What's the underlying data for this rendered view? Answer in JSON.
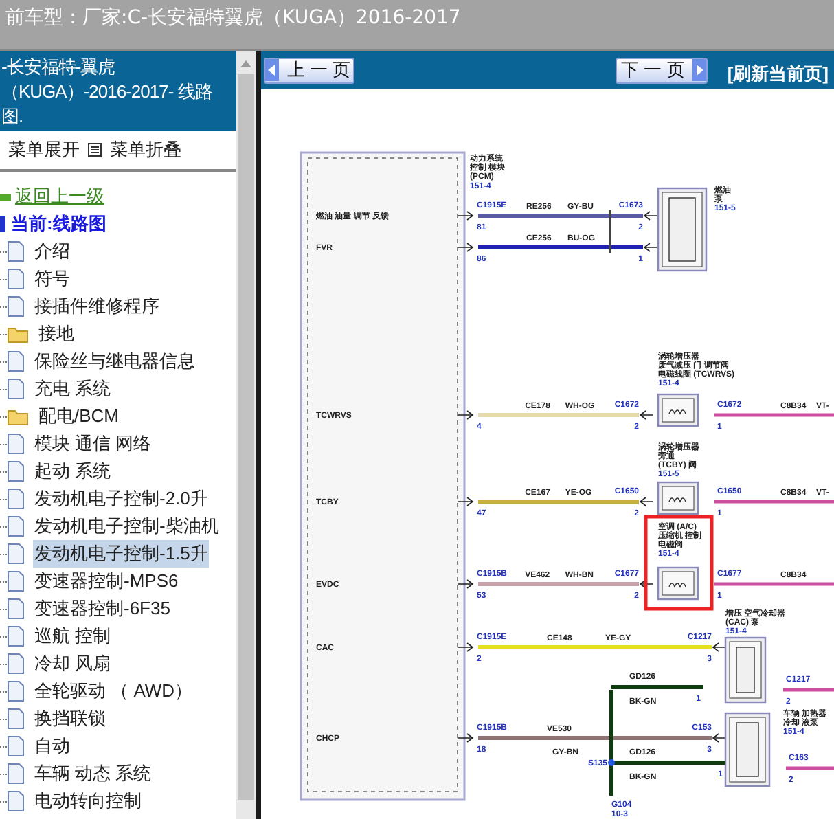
{
  "header": {
    "title": "前车型：厂家:C-长安福特翼虎（KUGA）2016-2017"
  },
  "sidebar": {
    "title_lines": [
      "-长安福特-翼虎",
      "（KUGA）-2016-2017- 线路",
      "图."
    ],
    "expand_label": "菜单展开",
    "collapse_label": "菜单折叠",
    "back_link": "返回上一级",
    "current": "当前:线路图",
    "items": [
      {
        "label": "介绍",
        "kind": "doc",
        "selected": false
      },
      {
        "label": "符号",
        "kind": "doc",
        "selected": false
      },
      {
        "label": "接插件维修程序",
        "kind": "doc",
        "selected": false
      },
      {
        "label": "接地",
        "kind": "folder",
        "selected": false
      },
      {
        "label": "保险丝与继电器信息",
        "kind": "doc",
        "selected": false
      },
      {
        "label": "充电 系统",
        "kind": "doc",
        "selected": false
      },
      {
        "label": "配电/BCM",
        "kind": "folder",
        "selected": false
      },
      {
        "label": "模块 通信 网络",
        "kind": "doc",
        "selected": false
      },
      {
        "label": "起动 系统",
        "kind": "doc",
        "selected": false
      },
      {
        "label": "发动机电子控制-2.0升",
        "kind": "doc",
        "selected": false
      },
      {
        "label": "发动机电子控制-柴油机",
        "kind": "doc",
        "selected": false
      },
      {
        "label": "发动机电子控制-1.5升",
        "kind": "doc",
        "selected": true
      },
      {
        "label": "变速器控制-MPS6",
        "kind": "doc",
        "selected": false
      },
      {
        "label": "变速器控制-6F35",
        "kind": "doc",
        "selected": false
      },
      {
        "label": "巡航 控制",
        "kind": "doc",
        "selected": false
      },
      {
        "label": "冷却 风扇",
        "kind": "doc",
        "selected": false
      },
      {
        "label": "全轮驱动 （ AWD）",
        "kind": "doc",
        "selected": false
      },
      {
        "label": "换挡联锁",
        "kind": "doc",
        "selected": false
      },
      {
        "label": "自动",
        "kind": "doc",
        "selected": false
      },
      {
        "label": "车辆 动态 系统",
        "kind": "doc",
        "selected": false
      },
      {
        "label": "电动转向控制",
        "kind": "doc",
        "selected": false
      }
    ]
  },
  "nav": {
    "prev": "上 一 页",
    "next": "下 一 页",
    "refresh": "[刷新当前页]"
  },
  "diagram": {
    "module": {
      "title_lines": [
        "动力系统",
        "控制 模块",
        "(PCM)"
      ],
      "ref": "151-4"
    },
    "wires": [
      {
        "signal": "燃油 油量 调节 反馈",
        "connector": "C1915E",
        "pin": "81",
        "circuit": "RE256",
        "color_code": "GY-BU",
        "end_connector": "C1673",
        "end_pin": "2",
        "color": "#5a5aa8"
      },
      {
        "signal": "FVR",
        "pin": "86",
        "circuit": "CE256",
        "color_code": "BU-OG",
        "end_pin": "1",
        "color": "#2222b0"
      },
      {
        "signal": "TCWRVS",
        "pin": "4",
        "circuit": "CE178",
        "color_code": "WH-OG",
        "end_connector": "C1672",
        "end_pin": "2",
        "color": "#e6dcae"
      },
      {
        "signal": "TCBY",
        "pin": "47",
        "circuit": "CE167",
        "color_code": "YE-OG",
        "end_connector": "C1650",
        "end_pin": "2",
        "color": "#c8b040"
      },
      {
        "signal": "EVDC",
        "connector": "C1915B",
        "pin": "53",
        "circuit": "VE462",
        "color_code": "WH-BN",
        "end_connector": "C1677",
        "end_pin": "2",
        "color": "#c9a2aa"
      },
      {
        "signal": "CAC",
        "connector": "C1915E",
        "pin": "2",
        "circuit": "CE148",
        "color_code": "YE-GY",
        "end_connector": "C1217",
        "end_pin": "3",
        "color": "#e4e020"
      },
      {
        "signal": "CHCP",
        "connector": "C1915B",
        "pin": "18",
        "circuit": "VE530",
        "color_code": "GY-BN",
        "end_connector": "C153",
        "end_pin": "3",
        "color": "#8f7272"
      }
    ],
    "components": [
      {
        "title_lines": [
          "燃油",
          "泵"
        ],
        "ref": "151-5"
      },
      {
        "title_lines": [
          "涡轮增压器",
          "废气减压 门 调节阀",
          "电磁线圈 (TCWRVS)"
        ],
        "ref": "151-4"
      },
      {
        "title_lines": [
          "涡轮增压器",
          "旁通",
          "(TCBY) 阀"
        ],
        "ref": "151-5"
      },
      {
        "title_lines": [
          "空调 (A/C)",
          "压缩机 控制",
          "电磁阀"
        ],
        "ref": "151-4"
      },
      {
        "title_lines": [
          "增压 空气冷却器",
          "(CAC) 泵"
        ],
        "ref": "151-4"
      },
      {
        "title_lines": [
          "车辆 加热器",
          "冷却 液泵"
        ],
        "ref": "151-4"
      }
    ],
    "outputs": [
      {
        "connector": "C1672",
        "pin": "1",
        "circuit": "C8B34",
        "color_code": "VT-"
      },
      {
        "connector": "C1650",
        "pin": "1",
        "circuit": "C8B34",
        "color_code": "VT-"
      },
      {
        "connector": "C1677",
        "pin": "1",
        "circuit": "C8B34"
      },
      {
        "connector": "C1217",
        "pin": "2"
      },
      {
        "connector": "C163",
        "pin": "2"
      }
    ],
    "grounds": [
      {
        "circuit": "GD126",
        "color_code": "BK-GN",
        "pin": "1"
      },
      {
        "circuit": "GD126",
        "color_code": "BK-GN",
        "pin": "1"
      }
    ],
    "splice": "S135",
    "ground_point": "G104",
    "ground_ref": "10-3",
    "highlight": true
  }
}
